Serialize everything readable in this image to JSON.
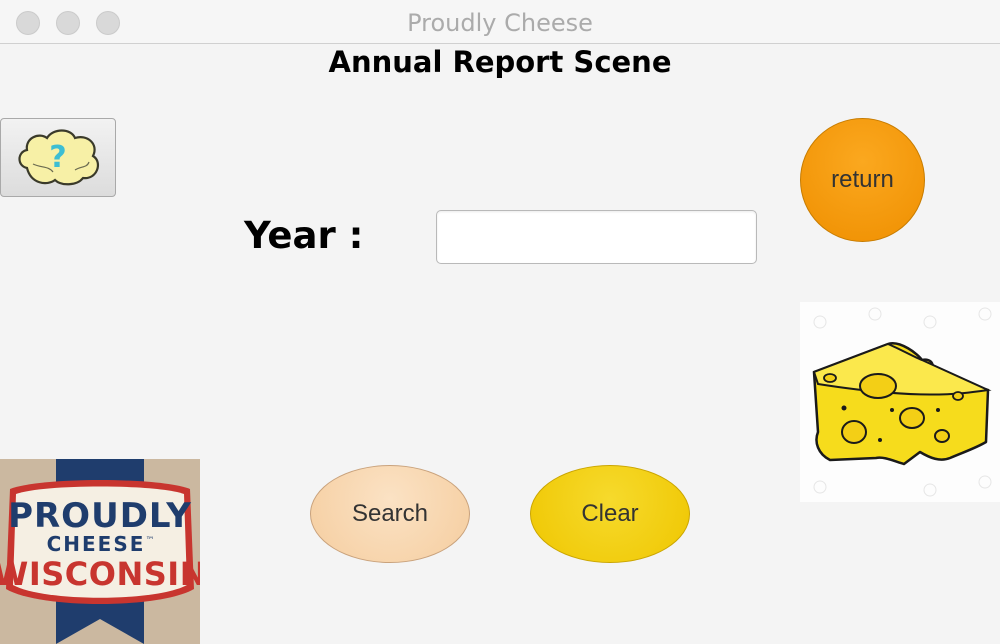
{
  "window": {
    "title": "Proudly Cheese",
    "controls": [
      "close-button",
      "minimize-button",
      "zoom-button"
    ]
  },
  "scene": {
    "title": "Annual Report Scene"
  },
  "help": {
    "icon": "help-cloud-icon",
    "glyph": "?"
  },
  "return_button": {
    "label": "return"
  },
  "form": {
    "year_label": "Year :",
    "year_value": "",
    "year_placeholder": ""
  },
  "actions": {
    "search_label": "Search",
    "clear_label": "Clear"
  },
  "logo": {
    "line1": "PROUDLY",
    "line2": "CHEESE",
    "tm": "™",
    "line3": "WISCONSIN"
  },
  "colors": {
    "return": "#f39a0c",
    "search": "#f7d6b0",
    "clear": "#f2cd12",
    "logo_navy": "#1f3d6d",
    "logo_red": "#c8352f"
  }
}
